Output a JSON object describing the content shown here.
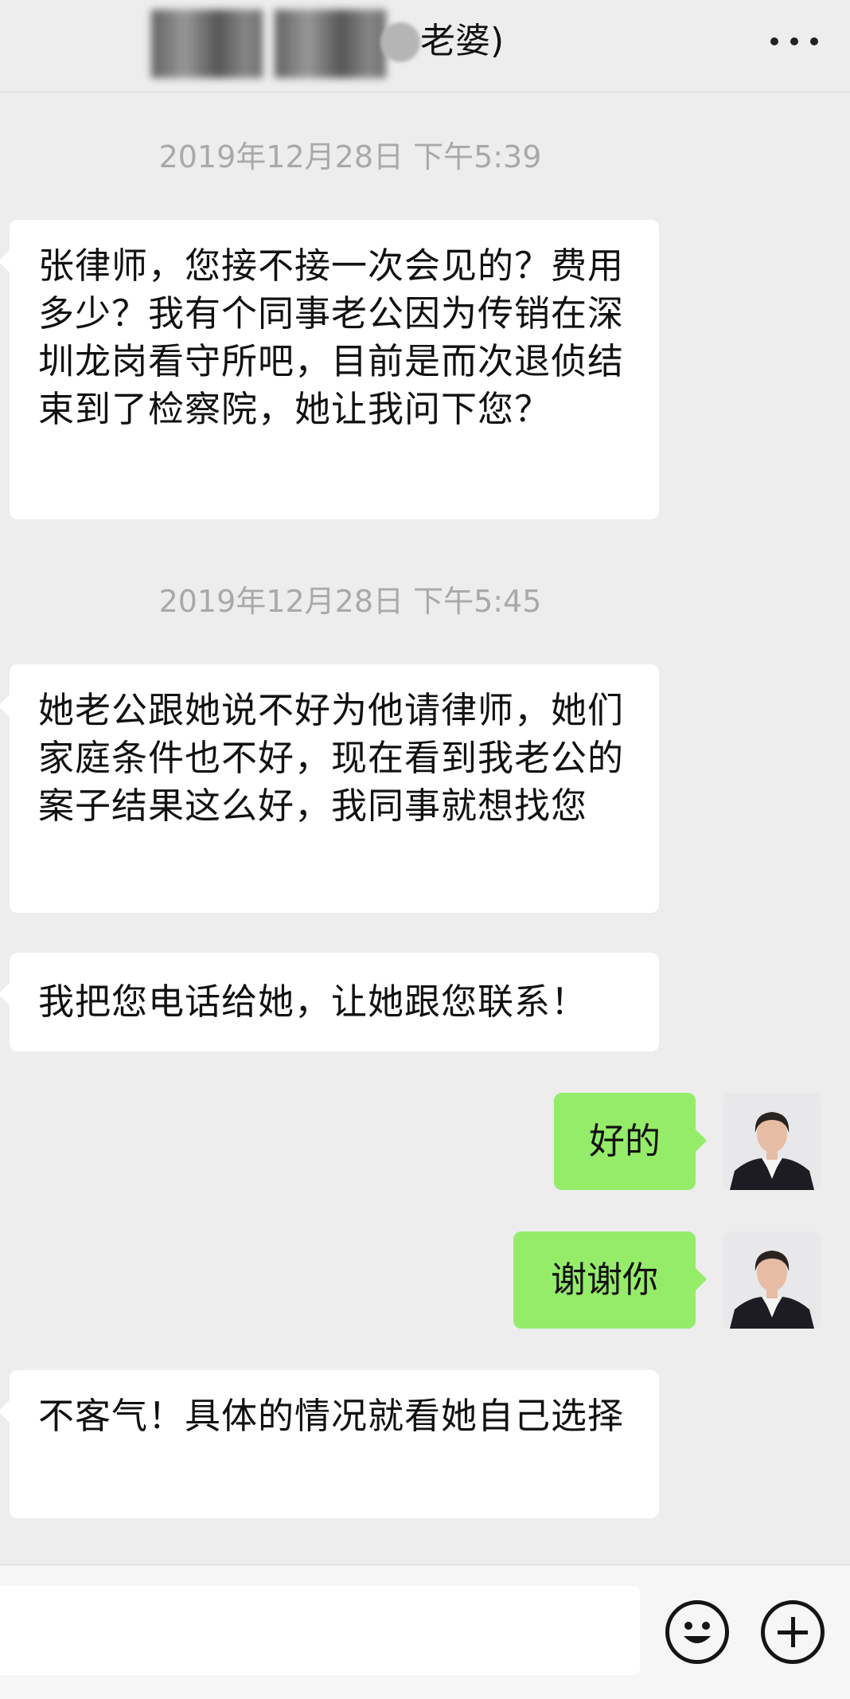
{
  "header": {
    "title_suffix": "老婆)",
    "more_icon": "more-icon"
  },
  "messages": [
    {
      "type": "timestamp",
      "text": "2019年12月28日 下午5:39"
    },
    {
      "type": "incoming",
      "text": "张律师，您接不接一次会见的？费用多少？我有个同事老公因为传销在深圳龙岗看守所吧，目前是而次退侦结束到了检察院，她让我问下您？"
    },
    {
      "type": "timestamp",
      "text": "2019年12月28日 下午5:45"
    },
    {
      "type": "incoming",
      "text": "她老公跟她说不好为他请律师，她们家庭条件也不好，现在看到我老公的案子结果这么好，我同事就想找您"
    },
    {
      "type": "incoming",
      "text": "我把您电话给她，让她跟您联系！"
    },
    {
      "type": "outgoing",
      "text": "好的"
    },
    {
      "type": "outgoing",
      "text": "谢谢你"
    },
    {
      "type": "incoming",
      "text": "不客气！具体的情况就看她自己选择"
    }
  ],
  "input_bar": {
    "input_value": "",
    "emoji_icon": "emoji-icon",
    "plus_icon": "plus-icon"
  },
  "colors": {
    "background": "#ededed",
    "incoming_bubble": "#ffffff",
    "outgoing_bubble": "#95ec69",
    "timestamp_text": "#a9a9a9"
  }
}
